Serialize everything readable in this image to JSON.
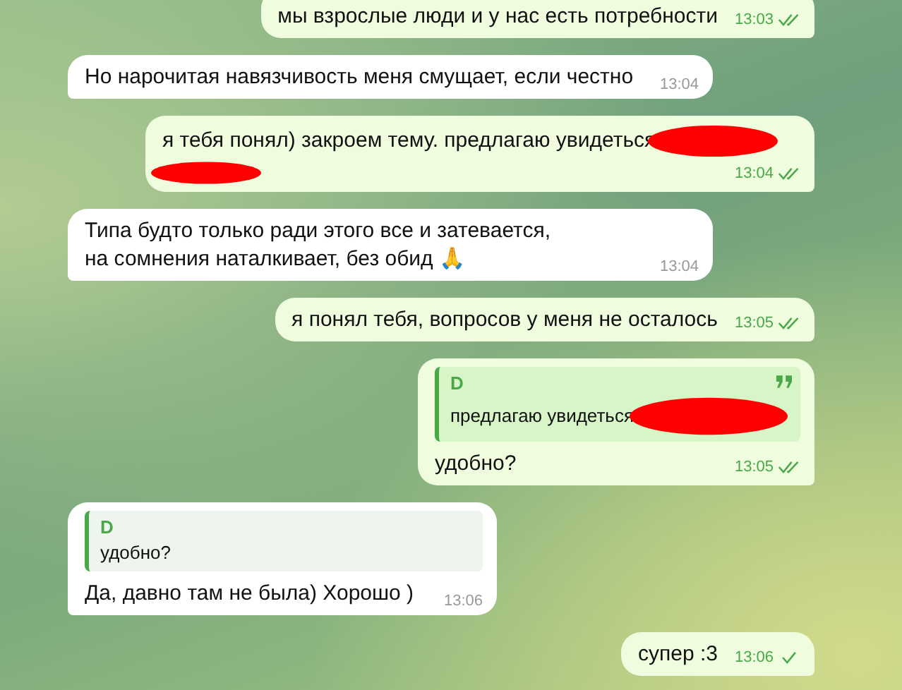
{
  "messages": [
    {
      "kind": "outgoing",
      "text": "мы взрослые люди и у нас есть потребности",
      "time": "13:03",
      "read": true
    },
    {
      "kind": "incoming",
      "text": "Но нарочитая навязчивость меня смущает, если честно",
      "time": "13:04"
    },
    {
      "kind": "outgoing",
      "text": "я тебя понял) закроем тему. предлагаю увидеться",
      "redacted": true,
      "time": "13:04",
      "read": true
    },
    {
      "kind": "incoming",
      "text": "Типа будто только ради этого все и затевается, на сомнения наталкивает, без обид 🙏",
      "time": "13:04"
    },
    {
      "kind": "outgoing",
      "text": "я понял тебя, вопросов у меня не осталось",
      "time": "13:05",
      "read": true
    },
    {
      "kind": "outgoing",
      "quote": {
        "author": "D",
        "text": "предлагаю увидеться",
        "redacted": true,
        "quote_mark": true
      },
      "text": "удобно?",
      "time": "13:05",
      "read": true
    },
    {
      "kind": "incoming",
      "quote": {
        "author": "D",
        "text": "удобно?"
      },
      "text": "Да, давно там не была) Хорошо )",
      "time": "13:06"
    },
    {
      "kind": "outgoing",
      "text": "супер :3",
      "time": "13:06",
      "read": false
    }
  ]
}
